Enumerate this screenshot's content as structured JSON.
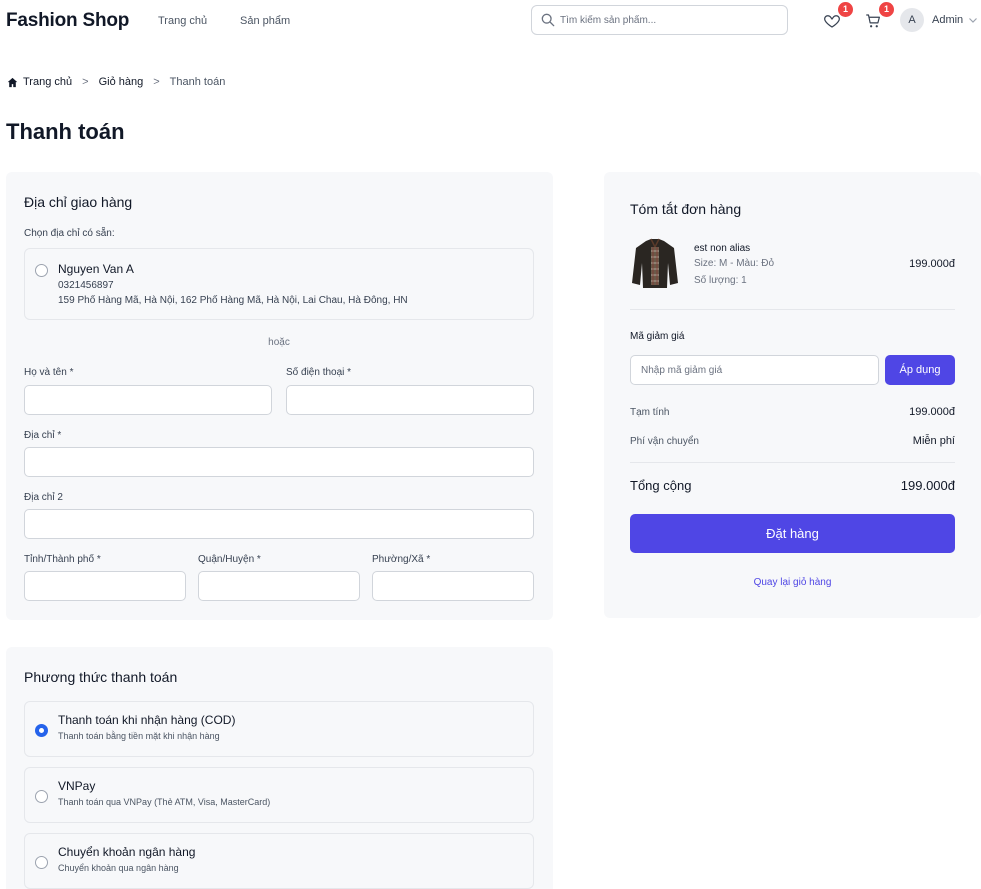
{
  "header": {
    "brand": "Fashion Shop",
    "nav": [
      "Trang chủ",
      "Sản phẩm"
    ],
    "search_placeholder": "Tìm kiếm sản phẩm...",
    "wishlist_count": "1",
    "cart_count": "1",
    "avatar_initial": "A",
    "user_name": "Admin"
  },
  "breadcrumb": [
    "Trang chủ",
    "Giỏ hàng",
    "Thanh toán"
  ],
  "page_title": "Thanh toán",
  "shipping": {
    "title": "Địa chỉ giao hàng",
    "choose_label": "Chọn địa chỉ có sẵn:",
    "saved_address": {
      "name": "Nguyen Van A",
      "phone": "0321456897",
      "address": "159 Phố Hàng Mã, Hà Nội, 162 Phố Hàng Mã, Hà Nội, Lai Chau, Hà Đông, HN"
    },
    "or_text": "hoặc",
    "fields": {
      "full_name": "Họ và tên *",
      "phone": "Số điện thoại *",
      "address": "Địa chỉ *",
      "address2": "Địa chỉ 2",
      "city": "Tỉnh/Thành phố *",
      "district": "Quận/Huyện *",
      "ward": "Phường/Xã *"
    }
  },
  "payment": {
    "title": "Phương thức thanh toán",
    "options": [
      {
        "title": "Thanh toán khi nhận hàng (COD)",
        "desc": "Thanh toán bằng tiền mặt khi nhận hàng",
        "selected": true
      },
      {
        "title": "VNPay",
        "desc": "Thanh toán qua VNPay (Thẻ ATM, Visa, MasterCard)",
        "selected": false
      },
      {
        "title": "Chuyển khoản ngân hàng",
        "desc": "Chuyển khoản qua ngân hàng",
        "selected": false
      }
    ]
  },
  "summary": {
    "title": "Tóm tắt đơn hàng",
    "item": {
      "name": "est non alias",
      "variant": "Size: M - Màu: Đỏ",
      "quantity": "Số lượng: 1",
      "price": "199.000đ"
    },
    "coupon_label": "Mã giảm giá",
    "coupon_placeholder": "Nhập mã giảm giá",
    "apply_label": "Áp dụng",
    "subtotal_label": "Tạm tính",
    "subtotal": "199.000đ",
    "shipping_label": "Phí vận chuyển",
    "shipping_value": "Miễn phí",
    "total_label": "Tổng cộng",
    "total": "199.000đ",
    "place_order": "Đặt hàng",
    "back_to_cart": "Quay lại giỏ hàng"
  },
  "colors": {
    "primary": "#4f46e5",
    "badge": "#ef4444",
    "radio_checked": "#2563eb",
    "card_bg": "#f7f8fa"
  }
}
